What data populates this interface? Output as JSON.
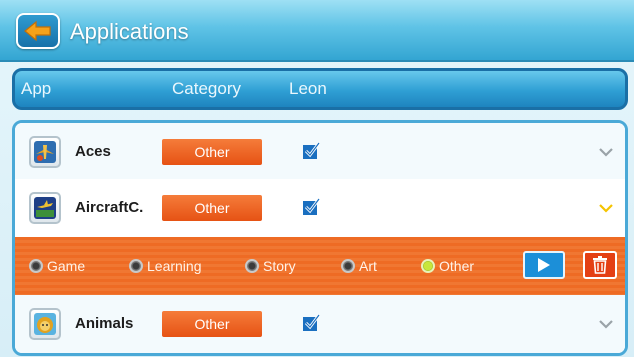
{
  "window": {
    "title": "Applications"
  },
  "icons": {
    "back": "back-arrow-icon",
    "check": "checkbox-checked-icon",
    "expand": "chevron-down-icon",
    "play": "play-icon",
    "delete": "trash-icon"
  },
  "colors": {
    "header_blue": "#2f9fd4",
    "accent_orange": "#e65214",
    "chevron_active": "#f5c400",
    "check_blue": "#1a6fc0"
  },
  "columns": [
    "App",
    "Category",
    "Leon"
  ],
  "apps": [
    {
      "name": "Aces",
      "category": "Other",
      "enabled": true,
      "expanded": false,
      "icon": "aces-app-icon"
    },
    {
      "name": "AircraftC.",
      "category": "Other",
      "enabled": true,
      "expanded": true,
      "icon": "aircraft-app-icon"
    },
    {
      "name": "Animals",
      "category": "Other",
      "enabled": true,
      "expanded": false,
      "icon": "animals-app-icon"
    }
  ],
  "category_options": [
    {
      "label": "Game",
      "selected": false
    },
    {
      "label": "Learning",
      "selected": false
    },
    {
      "label": "Story",
      "selected": false
    },
    {
      "label": "Art",
      "selected": false
    },
    {
      "label": "Other",
      "selected": true
    }
  ]
}
